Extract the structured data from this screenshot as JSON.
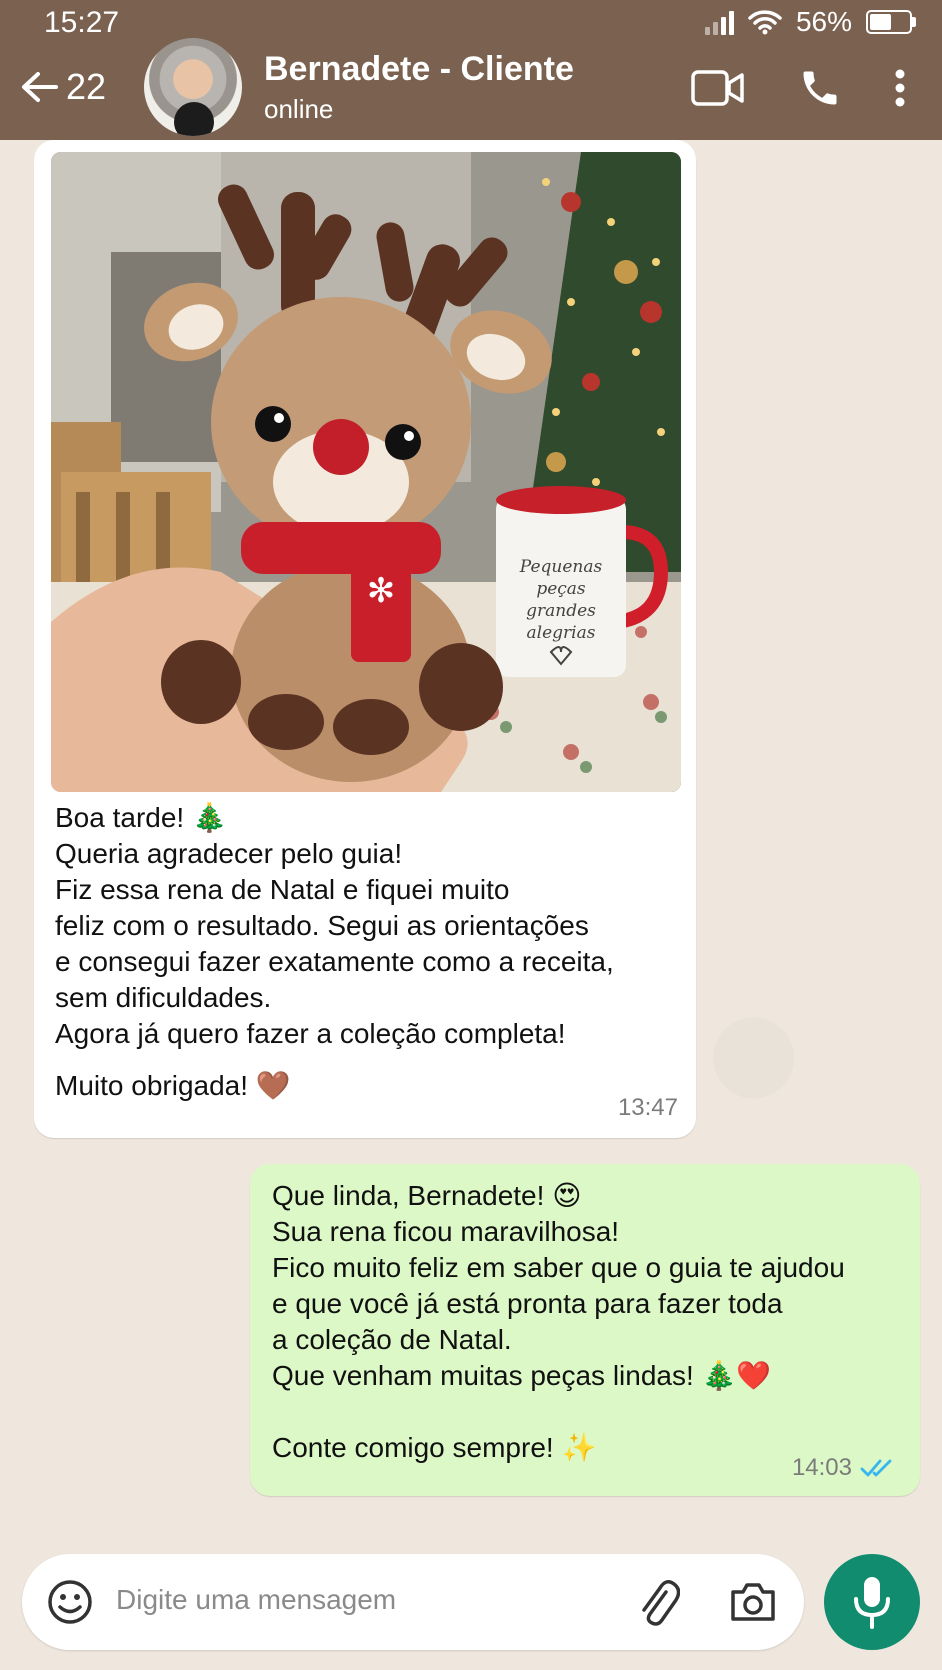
{
  "status_bar": {
    "time": "15:27",
    "battery": "56%",
    "battery_level": 0.56
  },
  "header": {
    "back_count": "22",
    "contact_name": "Bernadete - Cliente",
    "contact_status": "online",
    "video_icon": "video-call-icon",
    "call_icon": "phone-icon",
    "menu_icon": "more-vert-icon"
  },
  "messages": {
    "incoming": {
      "lines": [
        "Boa tarde! 🎄",
        "Queria agradecer pelo guia!",
        "Fiz essa rena de Natal e fiquei muito",
        "feliz com o resultado. Segui as orientações",
        "e consegui fazer exatamente como a receita,",
        "sem dificuldades.",
        "Agora já quero fazer a coleção completa!",
        "Muito obrigada! 🤎"
      ],
      "time": "13:47",
      "photo_mug_text": [
        "Pequenas",
        "peças",
        "grandes",
        "alegrias"
      ]
    },
    "outgoing": {
      "lines": [
        "Que linda, Bernadete! 😍",
        "Sua rena ficou maravilhosa!",
        "Fico muito feliz em saber que o guia te ajudou",
        "e que você já está pronta para fazer toda",
        "a coleção de Natal.",
        "Que venham muitas peças lindas! 🎄❤️",
        "Conte comigo sempre! ✨"
      ],
      "time": "14:03",
      "status": "read"
    }
  },
  "input": {
    "placeholder": "Digite uma mensagem"
  },
  "colors": {
    "header": "#7a6150",
    "outgoing_bubble": "#dcf8c6",
    "mic_button": "#128c6e",
    "read_ticks": "#34b7f1"
  }
}
